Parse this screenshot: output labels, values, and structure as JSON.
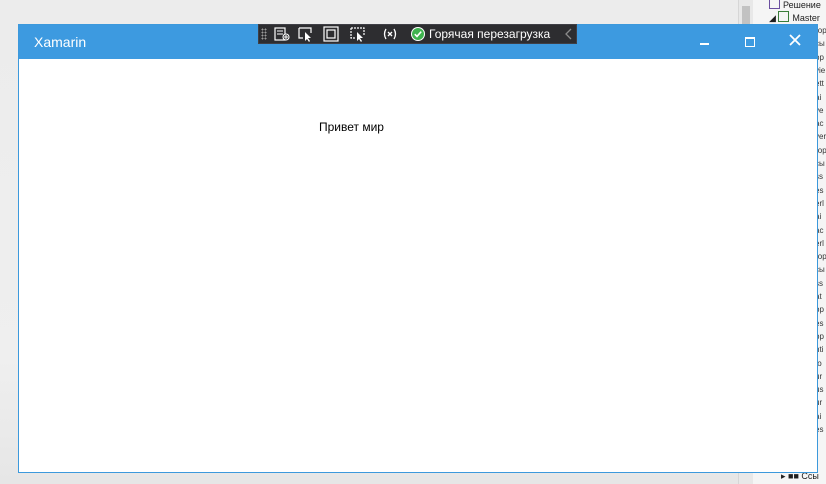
{
  "window": {
    "title": "Xamarin"
  },
  "debug_toolbar": {
    "icons": [
      "visual-tree-icon",
      "select-element-icon",
      "display-adorners-icon",
      "track-focus-icon",
      "binding-failures-icon"
    ],
    "hot_reload_label": "Горячая перезагрузка",
    "hot_reload_status_color": "#3fb34f"
  },
  "content": {
    "greeting": "Привет мир"
  },
  "ide": {
    "solution_label": "Решение",
    "project_label": "Master",
    "bottom_label": "Ссы",
    "row_fragments": [
      "гор",
      "сы",
      "ор",
      "vie",
      "ett",
      "ai",
      "ve",
      "ac",
      "ver",
      "гор",
      "сы",
      "ss",
      "es",
      "erl",
      "ai",
      "ac",
      "erl",
      "гор",
      "сы",
      "ss",
      "at",
      "ор",
      "es",
      "ор",
      "nti",
      "fo",
      "ur",
      "us",
      "ur",
      "ai",
      "es"
    ]
  },
  "colors": {
    "titlebar": "#3d9ae0",
    "toolbar": "#2d2d30"
  }
}
